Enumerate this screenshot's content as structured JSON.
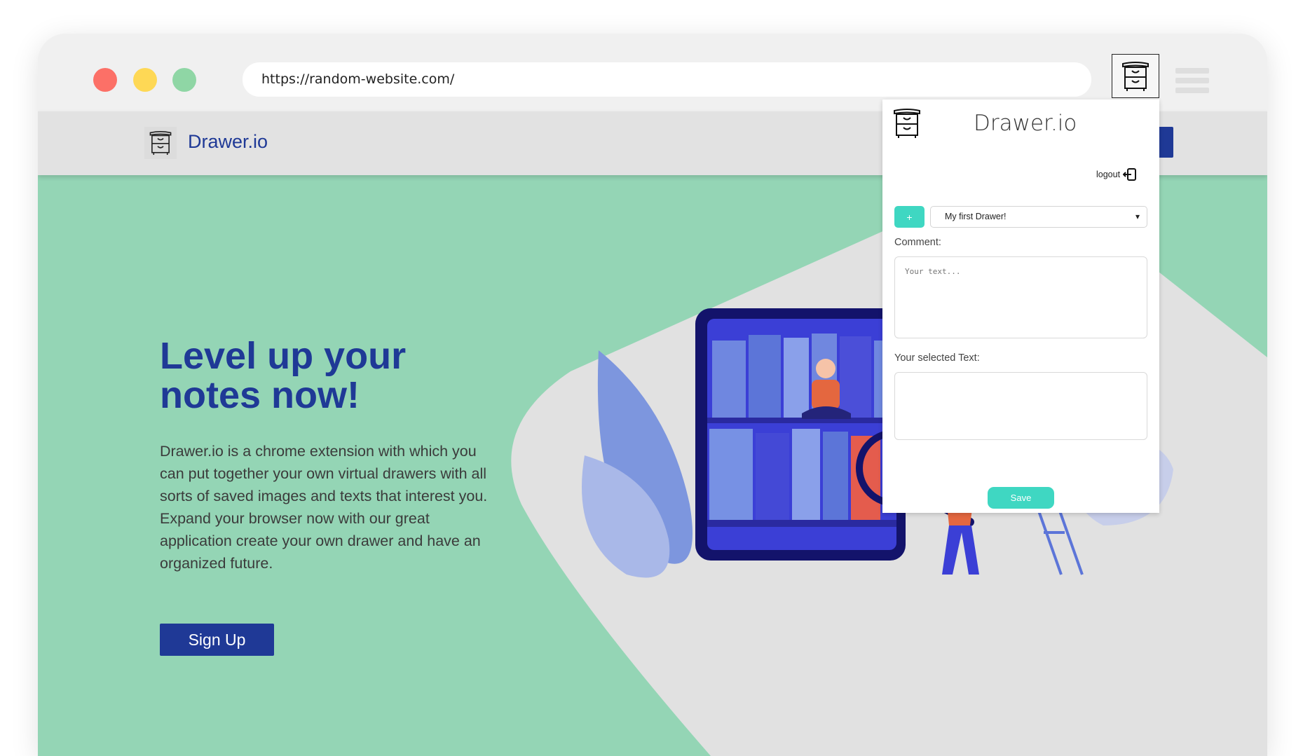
{
  "browser": {
    "url": "https://random-website.com/"
  },
  "site": {
    "brand": "Drawer.io",
    "headline_line1": "Level up your",
    "headline_line2": "notes now!",
    "description_p1": "Drawer.io is a chrome extension with which you can put together your own virtual drawers with all sorts of saved images and texts that interest you.",
    "description_p2": "Expand your browser now with our great application create your own drawer and have an organized future.",
    "signup_label": "Sign Up"
  },
  "popup": {
    "title": "Drawer.io",
    "logout_label": "logout",
    "add_label": "+",
    "selected_drawer": "My first Drawer!",
    "comment_label": "Comment:",
    "comment_placeholder": "Your text...",
    "selected_text_label": "Your selected Text:",
    "save_label": "Save"
  },
  "colors": {
    "brand_blue": "#1f3996",
    "hero_green": "#94d5b5",
    "accent_teal": "#3fd7c2"
  },
  "icons": [
    "drawer-cabinet-icon",
    "logout-icon",
    "chevron-down-icon",
    "hamburger-icon"
  ]
}
